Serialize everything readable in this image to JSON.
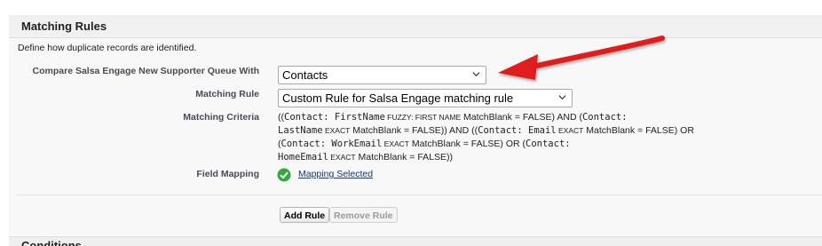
{
  "section": {
    "title": "Matching Rules",
    "description": "Define how duplicate records are identified."
  },
  "compare": {
    "label": "Compare Salsa Engage New Supporter Queue With",
    "value": "Contacts"
  },
  "matching_rule": {
    "label": "Matching Rule",
    "value": "Custom Rule for Salsa Engage matching rule"
  },
  "criteria": {
    "label": "Matching Criteria",
    "parts": {
      "p1": "((",
      "m1": "Contact: FirstName",
      "s1": " FUZZY: FIRST NAME",
      "t1": " MatchBlank = FALSE) AND (",
      "m2": "Contact:",
      "m3": "LastName",
      "s2": " EXACT",
      "t2": " MatchBlank = FALSE)) AND ((",
      "m4": "Contact: Email",
      "s3": " EXACT",
      "t3": " MatchBlank = FALSE) OR",
      "t4": "(",
      "m5": "Contact: WorkEmail",
      "s4": " EXACT",
      "t5": " MatchBlank = FALSE) OR (",
      "m6": "Contact:",
      "m7": "HomeEmail",
      "s5": " EXACT",
      "t6": " MatchBlank = FALSE))"
    }
  },
  "field_mapping": {
    "label": "Field Mapping",
    "link": "Mapping Selected",
    "icon": "green-check-icon"
  },
  "buttons": {
    "add_rule": "Add Rule",
    "remove_rule": "Remove Rule"
  },
  "next_section": {
    "title": "Conditions"
  },
  "colors": {
    "arrow": "#e01a1a",
    "check": "#35a845",
    "link": "#15386b"
  }
}
